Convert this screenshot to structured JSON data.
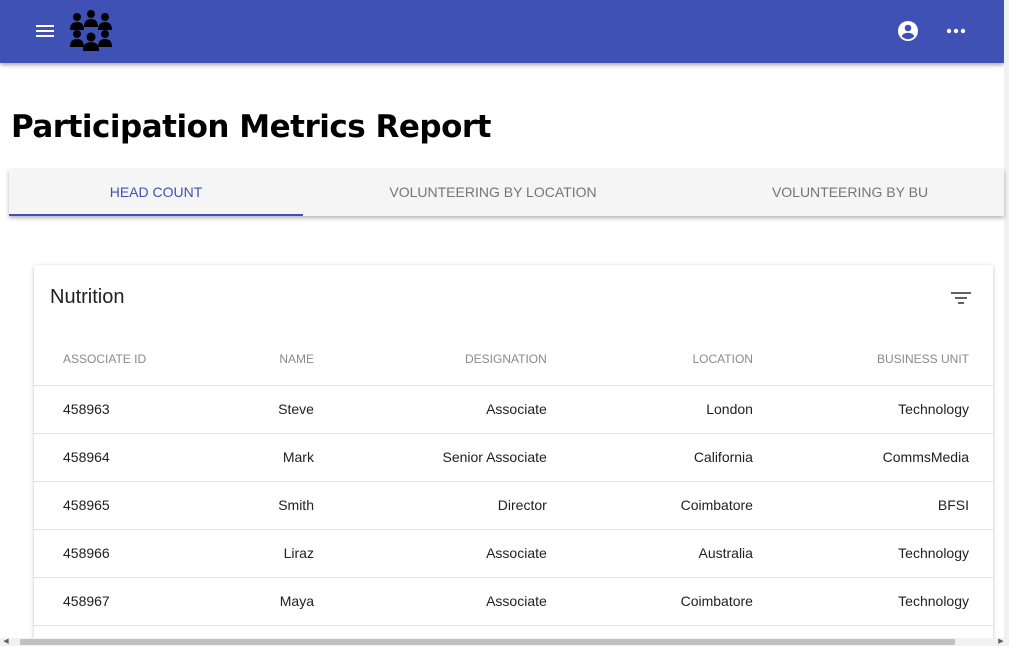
{
  "header": {
    "menu_icon": "menu-icon",
    "logo_icon": "people-group-icon",
    "account_icon": "account-circle-icon",
    "more_icon": "more-horizontal-icon",
    "bar_color": "#3f51b5"
  },
  "page": {
    "title": "Participation Metrics Report"
  },
  "tabs": [
    {
      "label": "HEAD COUNT",
      "active": true
    },
    {
      "label": "VOLUNTEERING BY LOCATION",
      "active": false
    },
    {
      "label": "VOLUNTEERING BY BU",
      "active": false
    }
  ],
  "card": {
    "title": "Nutrition",
    "filter_icon": "filter-list-icon"
  },
  "table": {
    "columns": [
      "ASSOCIATE ID",
      "NAME",
      "DESIGNATION",
      "LOCATION",
      "BUSINESS UNIT"
    ],
    "rows": [
      [
        "458963",
        "Steve",
        "Associate",
        "London",
        "Technology"
      ],
      [
        "458964",
        "Mark",
        "Senior Associate",
        "California",
        "CommsMedia"
      ],
      [
        "458965",
        "Smith",
        "Director",
        "Coimbatore",
        "BFSI"
      ],
      [
        "458966",
        "Liraz",
        "Associate",
        "Australia",
        "Technology"
      ],
      [
        "458967",
        "Maya",
        "Associate",
        "Coimbatore",
        "Technology"
      ]
    ]
  },
  "colors": {
    "accent": "#3f51b5",
    "tab_background": "#f5f5f5"
  }
}
